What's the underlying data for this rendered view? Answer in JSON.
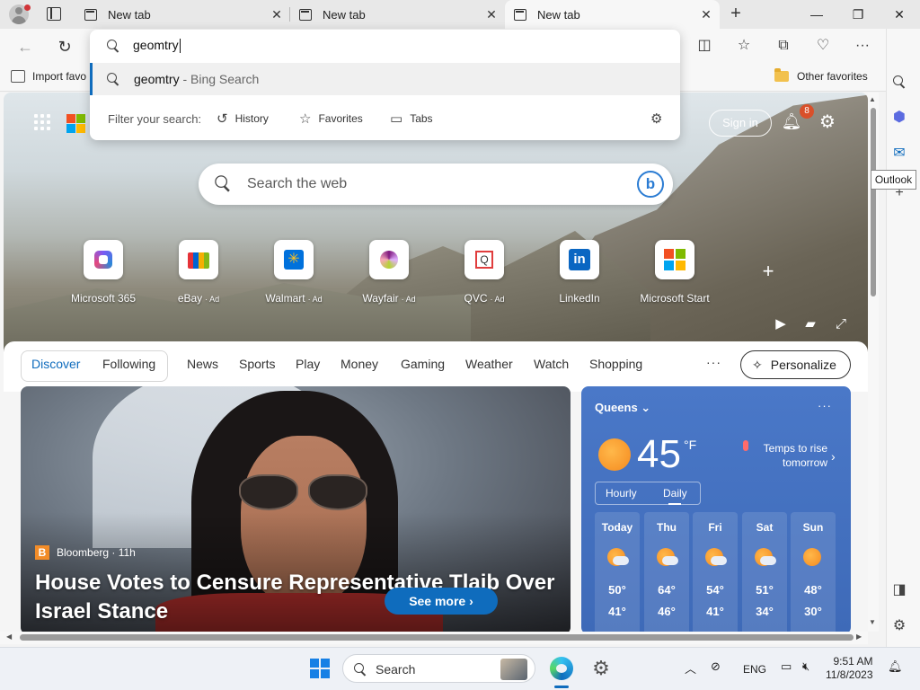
{
  "tabs": [
    {
      "label": "New tab",
      "active": false
    },
    {
      "label": "New tab",
      "active": false
    },
    {
      "label": "New tab",
      "active": true
    }
  ],
  "omnibox": {
    "query": "geomtry",
    "suggestion": "geomtry",
    "suggestion_source": " - Bing Search",
    "filter_label": "Filter your search:",
    "filters": [
      "History",
      "Favorites",
      "Tabs"
    ]
  },
  "favorites_bar": {
    "import_label": "Import favo",
    "other_label": "Other favorites"
  },
  "sidebar": {
    "tooltip": "Outlook"
  },
  "header": {
    "signin_label": "Sign in",
    "notification_count": "8"
  },
  "search": {
    "placeholder": "Search the web"
  },
  "quick_links": [
    {
      "label": "Microsoft 365",
      "ad": ""
    },
    {
      "label": "eBay",
      "ad": "· Ad"
    },
    {
      "label": "Walmart",
      "ad": "· Ad"
    },
    {
      "label": "Wayfair",
      "ad": "· Ad"
    },
    {
      "label": "QVC",
      "ad": "· Ad"
    },
    {
      "label": "LinkedIn",
      "ad": ""
    },
    {
      "label": "Microsoft Start",
      "ad": ""
    }
  ],
  "feed_nav": {
    "items": [
      "Discover",
      "Following",
      "News",
      "Sports",
      "Play",
      "Money",
      "Gaming",
      "Weather",
      "Watch",
      "Shopping"
    ],
    "more": "···",
    "personalize_label": "Personalize"
  },
  "news": {
    "source": "Bloomberg · 11h",
    "source_logo": "B",
    "headline": "House Votes to Censure Representative Tlaib Over Israel Stance",
    "see_more": "See more"
  },
  "weather": {
    "location": "Queens",
    "temp": "45",
    "unit": "°F",
    "alert": "Temps to rise tomorrow",
    "toggle": [
      "Hourly",
      "Daily"
    ],
    "days": [
      {
        "name": "Today",
        "hi": "50°",
        "lo": "41°",
        "icon": "partly-cloudy"
      },
      {
        "name": "Thu",
        "hi": "64°",
        "lo": "46°",
        "icon": "partly-cloudy"
      },
      {
        "name": "Fri",
        "hi": "54°",
        "lo": "41°",
        "icon": "partly-cloudy"
      },
      {
        "name": "Sat",
        "hi": "51°",
        "lo": "34°",
        "icon": "partly-cloudy"
      },
      {
        "name": "Sun",
        "hi": "48°",
        "lo": "30°",
        "icon": "sunny"
      }
    ]
  },
  "taskbar": {
    "search_label": "Search",
    "language": "ENG",
    "time": "9:51 AM",
    "date": "11/8/2023"
  },
  "colors": {
    "accent": "#0f6cbd",
    "weather_bg": "#4a78c8"
  }
}
